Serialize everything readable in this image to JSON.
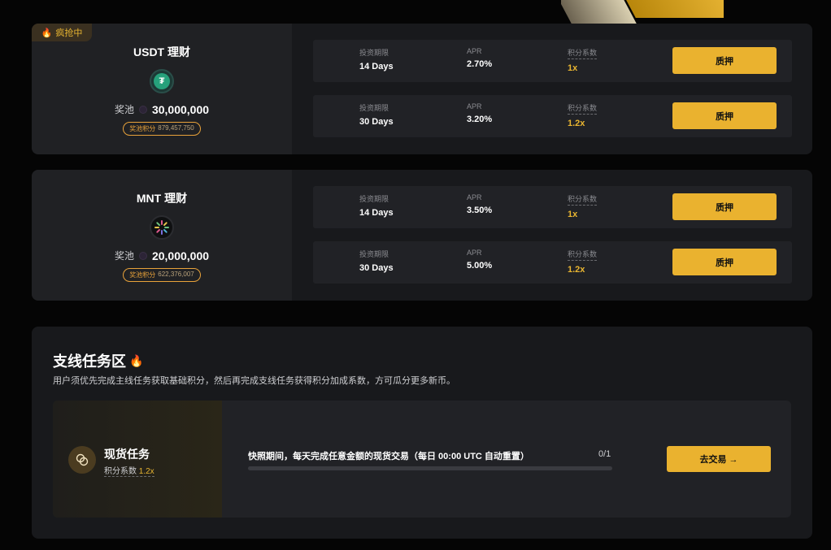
{
  "products": [
    {
      "hot_badge": "疯抢中",
      "name": "USDT 理财",
      "coin_icon": "tether-icon",
      "pool_label": "奖池",
      "pool_amount": "30,000,000",
      "points_label": "奖池积分",
      "points_value": "879,457,750",
      "terms": [
        {
          "term_label": "投资期限",
          "term": "14 Days",
          "apr_label": "APR",
          "apr": "2.70%",
          "mult_label": "积分系数",
          "mult": "1x",
          "button": "质押"
        },
        {
          "term_label": "投资期限",
          "term": "30 Days",
          "apr_label": "APR",
          "apr": "3.20%",
          "mult_label": "积分系数",
          "mult": "1.2x",
          "button": "质押"
        }
      ]
    },
    {
      "hot_badge": "",
      "name": "MNT 理财",
      "coin_icon": "mantle-icon",
      "pool_label": "奖池",
      "pool_amount": "20,000,000",
      "points_label": "奖池积分",
      "points_value": "622,376,007",
      "terms": [
        {
          "term_label": "投资期限",
          "term": "14 Days",
          "apr_label": "APR",
          "apr": "3.50%",
          "mult_label": "积分系数",
          "mult": "1x",
          "button": "质押"
        },
        {
          "term_label": "投资期限",
          "term": "30 Days",
          "apr_label": "APR",
          "apr": "5.00%",
          "mult_label": "积分系数",
          "mult": "1.2x",
          "button": "质押"
        }
      ]
    }
  ],
  "side_tasks": {
    "title": "支线任务区",
    "description": "用户须优先完成主线任务获取基础积分，然后再完成支线任务获得积分加成系数，方可瓜分更多新币。",
    "task": {
      "name": "现货任务",
      "mult_label": "积分系数",
      "mult": "1.2x",
      "text": "快照期间，每天完成任意金额的现货交易（每日 00:00 UTC 自动重置）",
      "progress_text": "0/1",
      "progress": 0,
      "button": "去交易 →"
    }
  },
  "colors": {
    "accent": "#eab22f",
    "gold_text": "#e8b531",
    "card_bg": "#18191c"
  }
}
